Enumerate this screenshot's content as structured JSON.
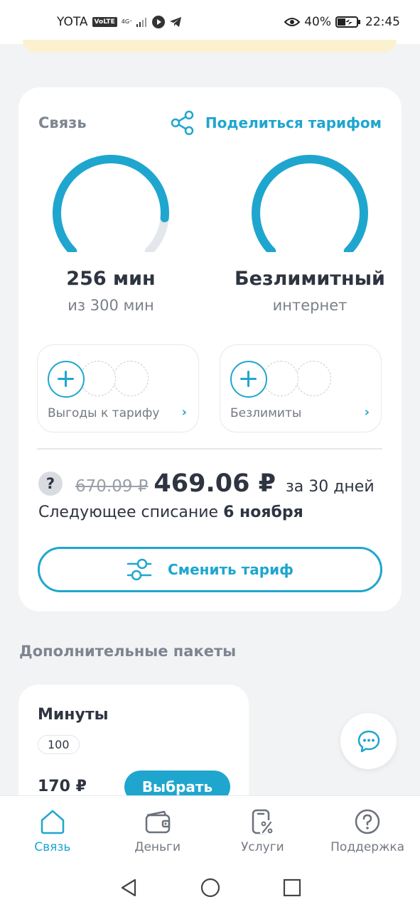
{
  "status_bar": {
    "carrier": "YOTA",
    "volte": "VoLTE",
    "network": "4G⁺",
    "battery": "40%",
    "time": "22:45"
  },
  "tariff_card": {
    "title": "Связь",
    "share_label": "Поделиться тарифом",
    "minutes": {
      "value": "256 мин",
      "sub": "из 300 мин",
      "fraction": 0.853
    },
    "internet": {
      "value": "Безлимитный",
      "sub": "интернет",
      "fraction": 1.0
    },
    "tiles": [
      {
        "label": "Выгоды к тарифу"
      },
      {
        "label": "Безлимиты"
      }
    ],
    "help_symbol": "?",
    "old_price": "670.09 ₽",
    "new_price": "469.06 ₽",
    "period": "за 30 дней",
    "next_charge_prefix": "Следующее списание ",
    "next_charge_date": "6 ноября",
    "change_button": "Сменить тариф"
  },
  "extra_packages": {
    "title": "Дополнительные пакеты",
    "package": {
      "title": "Минуты",
      "amount": "100",
      "price": "170 ₽",
      "button": "Выбрать"
    }
  },
  "bottom_nav": [
    {
      "label": "Связь",
      "icon": "home-icon",
      "active": true
    },
    {
      "label": "Деньги",
      "icon": "wallet-icon",
      "active": false
    },
    {
      "label": "Услуги",
      "icon": "services-icon",
      "active": false
    },
    {
      "label": "Поддержка",
      "icon": "help-icon",
      "active": false
    }
  ],
  "colors": {
    "accent": "#1fa6cf",
    "track": "#e3e6ea",
    "banner": "#fbf1cf"
  }
}
